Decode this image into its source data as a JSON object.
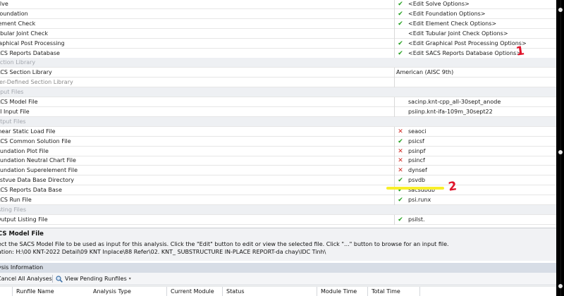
{
  "rows": [
    {
      "kind": "prop",
      "name": "olve",
      "mark": "ok",
      "value": "<Edit Solve Options>"
    },
    {
      "kind": "prop",
      "name": "Foundation",
      "mark": "ok",
      "value": "<Edit Foundation Options>"
    },
    {
      "kind": "prop",
      "name": "lement Check",
      "mark": "ok",
      "value": "<Edit Element Check Options>"
    },
    {
      "kind": "prop",
      "name": "ubular Joint Check",
      "mark": "",
      "value": "<Edit Tubular Joint Check Options>"
    },
    {
      "kind": "prop",
      "name": "raphical Post Processing",
      "mark": "ok",
      "value": "<Edit Graphical Post Processing Options>"
    },
    {
      "kind": "prop",
      "name": "ACS Reports Database",
      "mark": "ok",
      "value": "<Edit SACS Reports Database Options>"
    },
    {
      "kind": "section",
      "name": "ection Library"
    },
    {
      "kind": "prop",
      "name": "ACS Section Library",
      "mark": "",
      "value": "American (AISC 9th)",
      "lib": true
    },
    {
      "kind": "prop",
      "name": "ser-Defined Section Library",
      "mark": "",
      "value": "",
      "disabled": true
    },
    {
      "kind": "section",
      "name": "nput Files"
    },
    {
      "kind": "prop",
      "name": "ACS Model File",
      "mark": "",
      "value": "sacinp.knt-cpp_all-30sept_anode"
    },
    {
      "kind": "prop",
      "name": "SI Input File",
      "mark": "",
      "value": "psiinp.knt-ifa-109m_30sept22"
    },
    {
      "kind": "section",
      "name": "utput Files"
    },
    {
      "kind": "prop",
      "name": "inear Static Load File",
      "mark": "bad",
      "value": "seaoci"
    },
    {
      "kind": "prop",
      "name": "ACS Common Solution File",
      "mark": "ok",
      "value": "psicsf"
    },
    {
      "kind": "prop",
      "name": "oundation Plot File",
      "mark": "bad",
      "value": "psinpf"
    },
    {
      "kind": "prop",
      "name": "oundation Neutral Chart File",
      "mark": "bad",
      "value": "psincf"
    },
    {
      "kind": "prop",
      "name": "oundation Superelement File",
      "mark": "bad",
      "value": "dynsef"
    },
    {
      "kind": "prop",
      "name": "ostvue Data Base Directory",
      "mark": "ok",
      "value": "psvdb"
    },
    {
      "kind": "prop",
      "name": "ACS Reports Data Base",
      "mark": "ok",
      "value": "sacsdbdb"
    },
    {
      "kind": "prop",
      "name": "ACS Run File",
      "mark": "ok",
      "value": "psi.runx"
    },
    {
      "kind": "section",
      "name": "isting Files"
    },
    {
      "kind": "prop",
      "name": "Output Listing File",
      "mark": "ok",
      "value": "psilst."
    }
  ],
  "marks": {
    "ok": "✔",
    "bad": "✕"
  },
  "annotations": {
    "one": "1",
    "two": "2"
  },
  "description": {
    "title": "CS Model File",
    "line1": "ect the SACS Model File to be used as input for this analysis.  Click the \"Edit\" button to edit or view the selected file. Click \"...\" button to browse for an input file.",
    "line2": "ation: H:\\00 KNT-2022 Detail\\09 KNT Inplace\\88 Refer\\02. KNT_ SUBSTRUCTURE IN-PLACE REPORT-da chay\\IDC Tinh\\"
  },
  "analysis": {
    "header": "ysis Information",
    "cancel_all": "Cancel All Analyses",
    "view_pending": "View Pending Runfiles",
    "view_pending_icon": "magnifier-icon",
    "columns": [
      "Runfile Name",
      "Analysis Type",
      "Current Module",
      "Status",
      "Module Time",
      "Total Time"
    ]
  },
  "colors": {
    "ok": "#23a01e",
    "bad": "#d0251f",
    "annotation": "#e0142b",
    "highlight": "#f8ef2a"
  }
}
